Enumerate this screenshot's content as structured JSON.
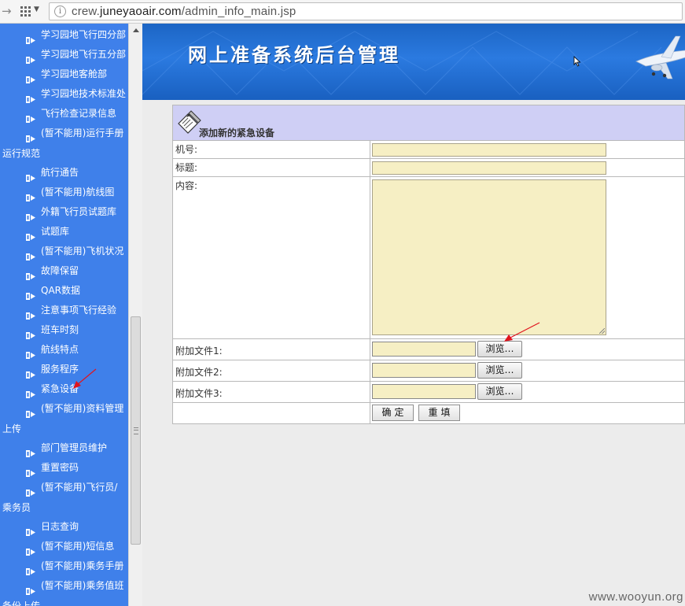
{
  "browser": {
    "url_prefix": "crew.",
    "url_domain": "juneyaoair.com",
    "url_path": "/admin_info_main.jsp"
  },
  "sidebar": {
    "items": [
      {
        "label": "学习园地飞行四分部"
      },
      {
        "label": "学习园地飞行五分部"
      },
      {
        "label": "学习园地客舱部"
      },
      {
        "label": "学习园地技术标准处"
      },
      {
        "label": "飞行检查记录信息"
      },
      {
        "label": "(暂不能用)运行手册"
      },
      {
        "label": "航行通告"
      },
      {
        "label": "(暂不能用)航线图"
      },
      {
        "label": "外籍飞行员试题库"
      },
      {
        "label": "试题库"
      },
      {
        "label": "(暂不能用)飞机状况"
      },
      {
        "label": "故障保留"
      },
      {
        "label": "QAR数据"
      },
      {
        "label": "注意事项飞行经验"
      },
      {
        "label": "班车时刻"
      },
      {
        "label": "航线特点"
      },
      {
        "label": "服务程序"
      },
      {
        "label": "紧急设备"
      },
      {
        "label": "(暂不能用)资料管理"
      },
      {
        "label": "部门管理员维护"
      },
      {
        "label": "重置密码"
      },
      {
        "label": "(暂不能用)飞行员/"
      },
      {
        "label": "日志查询"
      },
      {
        "label": "(暂不能用)短信息"
      },
      {
        "label": "(暂不能用)乘务手册"
      },
      {
        "label": "(暂不能用)乘务值班"
      }
    ],
    "wrap_lines": [
      "运行规范",
      "上传",
      "乘务员",
      "备份上传"
    ]
  },
  "banner": {
    "title": "网上准备系统后台管理"
  },
  "form": {
    "header": "添加新的紧急设备",
    "fields": {
      "machine_no": "机号:",
      "title": "标题:",
      "content": "内容:",
      "attach1": "附加文件1:",
      "attach2": "附加文件2:",
      "attach3": "附加文件3:"
    },
    "browse_label": "浏览…",
    "submit_label": "确定",
    "reset_label": "重填"
  },
  "watermark": "www.wooyun.org",
  "colors": {
    "sidebar_bg": "#3f80ea",
    "banner_bg": "#2b7ae0",
    "form_header_bg": "#cfcff5",
    "input_bg": "#f6efc4",
    "annotation_arrow": "#e0141e"
  }
}
